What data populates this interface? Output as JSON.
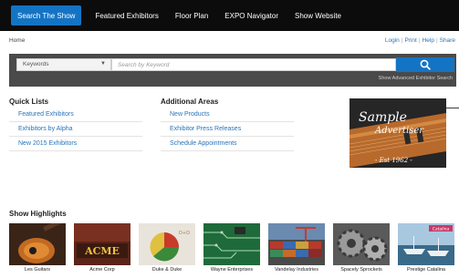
{
  "nav": {
    "tabs": [
      {
        "label": "Search The Show",
        "active": true
      },
      {
        "label": "Featured Exhibitors",
        "active": false
      },
      {
        "label": "Floor Plan",
        "active": false
      },
      {
        "label": "EXPO Navigator",
        "active": false
      },
      {
        "label": "Show Website",
        "active": false
      }
    ]
  },
  "breadcrumb": "Home",
  "utility": {
    "login": "Login",
    "print": "Print",
    "help": "Help",
    "share": "Share",
    "separator": "|"
  },
  "search": {
    "select_value": "Keywords",
    "placeholder": "Search by Keyword",
    "advanced_link": "Show Advanced Exhibitor Search"
  },
  "quick_lists": {
    "title": "Quick Lists",
    "items": [
      "Featured Exhibitors",
      "Exhibitors by Alpha",
      "New 2015 Exhibitors"
    ]
  },
  "additional_areas": {
    "title": "Additional Areas",
    "items": [
      "New Products",
      "Exhibitor Press Releases",
      "Schedule Appointments"
    ]
  },
  "advertiser": {
    "line1": "Sample",
    "line2": "Advertiser",
    "est": "- Est 1962 -"
  },
  "highlights": {
    "title": "Show Highlights",
    "items": [
      {
        "caption": "Les Guitars",
        "icon": "guitar-image"
      },
      {
        "caption": "Acme Corp",
        "icon": "acme-sign-image",
        "sign": "ACME"
      },
      {
        "caption": "Duke & Duke",
        "icon": "pie-chart-image",
        "sign": "D+D"
      },
      {
        "caption": "Wayne Enterprises",
        "icon": "circuit-board-image"
      },
      {
        "caption": "Vandelay Industries",
        "icon": "shipping-containers-image"
      },
      {
        "caption": "Spacely Sprockets",
        "icon": "gears-image"
      },
      {
        "caption": "Prestige Catalina",
        "icon": "boats-image",
        "sign": "Catalina"
      }
    ]
  },
  "colors": {
    "nav_bg": "#0c0c0c",
    "accent": "#1474c4",
    "link": "#2a74b8",
    "search_band": "#4a4a4a"
  }
}
